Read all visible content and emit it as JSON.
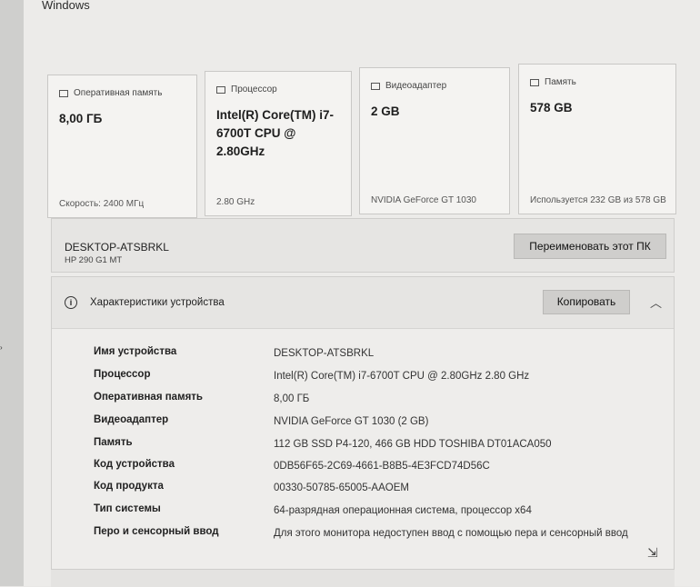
{
  "window": {
    "title": "Windows"
  },
  "cards": [
    {
      "title": "Оперативная память",
      "value": "8,00 ГБ",
      "foot": "Скорость: 2400 МГц",
      "icon": "ram-icon"
    },
    {
      "title": "Процессор",
      "value": "Intel(R) Core(TM) i7-6700T CPU @ 2.80GHz",
      "foot": "2.80 GHz",
      "icon": "cpu-icon"
    },
    {
      "title": "Видеоадаптер",
      "value": "2 GB",
      "foot": "NVIDIA GeForce GT 1030",
      "icon": "gpu-icon"
    },
    {
      "title": "Память",
      "value": "578 GB",
      "foot": "Используется 232 GB из 578 GB",
      "icon": "storage-icon"
    }
  ],
  "pc": {
    "name": "DESKTOP-ATSBRKL",
    "model": "HP 290 G1 MT",
    "rename_label": "Переименовать этот ПК"
  },
  "specs": {
    "title": "Характеристики устройства",
    "copy_label": "Копировать",
    "rows": [
      {
        "label": "Имя устройства",
        "value": "DESKTOP-ATSBRKL"
      },
      {
        "label": "Процессор",
        "value": "Intel(R) Core(TM) i7-6700T CPU @ 2.80GHz   2.80 GHz"
      },
      {
        "label": "Оперативная память",
        "value": "8,00 ГБ"
      },
      {
        "label": "Видеоадаптер",
        "value": "NVIDIA GeForce GT 1030 (2 GB)"
      },
      {
        "label": "Память",
        "value": "112 GB SSD P4-120, 466 GB HDD TOSHIBA DT01ACA050"
      },
      {
        "label": "Код устройства",
        "value": "0DB56F65-2C69-4661-B8B5-4E3FCD74D56C"
      },
      {
        "label": "Код продукта",
        "value": "00330-50785-65005-AAOEM"
      },
      {
        "label": "Тип системы",
        "value": "64-разрядная операционная система, процессор x64"
      },
      {
        "label": "Перо и сенсорный ввод",
        "value": "Для этого монитора недоступен ввод с помощью пера и сенсорный ввод"
      }
    ]
  }
}
